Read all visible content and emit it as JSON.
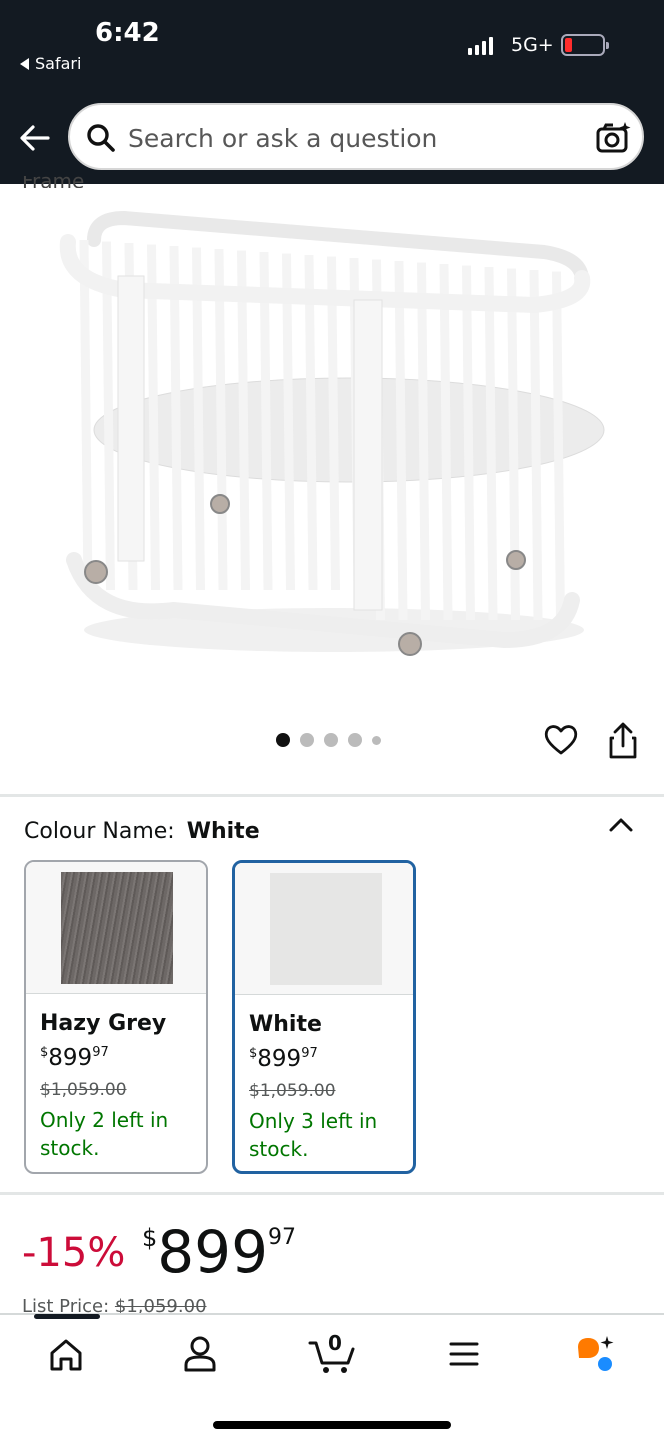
{
  "status_bar": {
    "time": "6:42",
    "back_app": "Safari",
    "network": "5G+"
  },
  "search": {
    "placeholder": "Search or ask a question"
  },
  "product_image": {
    "cut_text": "Frame",
    "dot_count": 5,
    "active_dot": 0
  },
  "colour": {
    "label": "Colour Name:",
    "selected": "White",
    "options": [
      {
        "name": "Hazy Grey",
        "currency": "$",
        "price_whole": "899",
        "price_fraction": "97",
        "list_price": "$1,059.00",
        "stock": "Only 2 left in stock.",
        "swatch_color": "#6d6866"
      },
      {
        "name": "White",
        "currency": "$",
        "price_whole": "899",
        "price_fraction": "97",
        "list_price": "$1,059.00",
        "stock": "Only 3 left in stock.",
        "swatch_color": "#e6e6e5"
      }
    ]
  },
  "price": {
    "discount": "-15%",
    "currency": "$",
    "whole": "899",
    "fraction": "97",
    "list_label": "List Price:",
    "list_value": "$1,059.00"
  },
  "bottom_nav": {
    "items": [
      "home-icon",
      "account-icon",
      "cart-icon",
      "menu-icon",
      "rufus-icon"
    ],
    "cart_count": "0",
    "brand_colors": {
      "orange": "#ff7a00",
      "blue": "#1a8cff"
    }
  }
}
